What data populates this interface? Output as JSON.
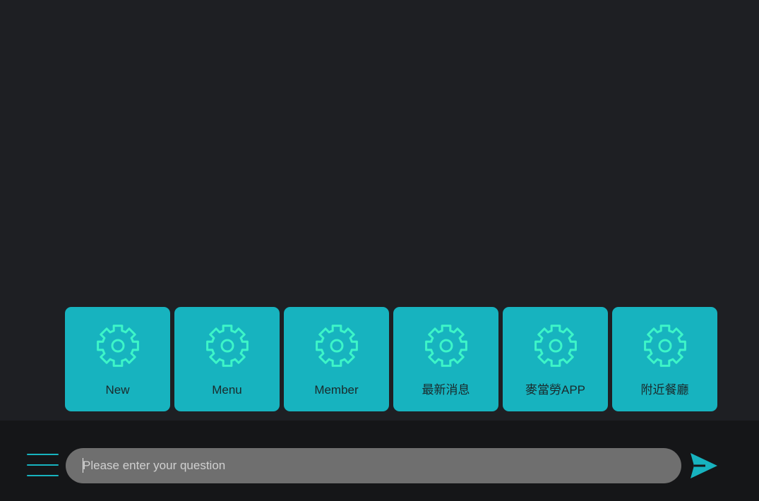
{
  "colors": {
    "background": "#1e1f23",
    "bottom_bar": "#151618",
    "accent": "#17b3bf",
    "icon_stroke": "#3df5c8",
    "input_background": "#6f6f6f"
  },
  "quick_actions": [
    {
      "label": "New",
      "icon": "gear-icon"
    },
    {
      "label": "Menu",
      "icon": "gear-icon"
    },
    {
      "label": "Member",
      "icon": "gear-icon"
    },
    {
      "label": "最新消息",
      "icon": "gear-icon"
    },
    {
      "label": "麥當勞APP",
      "icon": "gear-icon"
    },
    {
      "label": "附近餐廳",
      "icon": "gear-icon"
    }
  ],
  "chat_input": {
    "value": "",
    "placeholder": "Please enter your question"
  },
  "icons": {
    "menu": "hamburger-menu-icon",
    "send": "send-icon"
  }
}
